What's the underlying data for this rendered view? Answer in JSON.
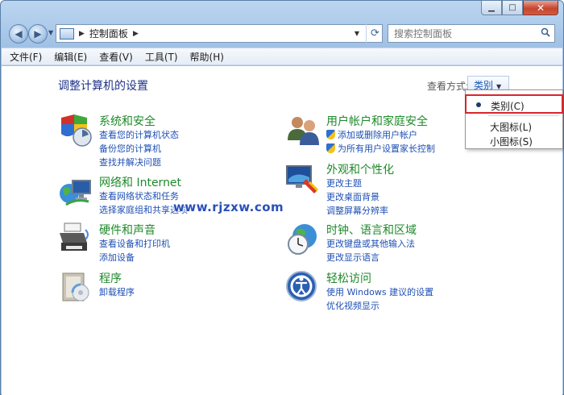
{
  "window": {
    "caption": {
      "minimize_glyph": "▁",
      "maximize_glyph": "□",
      "close_glyph": "✕"
    }
  },
  "nav": {
    "back_glyph": "◀",
    "forward_glyph": "▶",
    "address_path": "控制面板",
    "address_sep": "▶",
    "address_tail": "▶",
    "refresh_glyph": "⟳",
    "search_placeholder": "搜索控制面板"
  },
  "menubar": {
    "items": [
      "文件(F)",
      "编辑(E)",
      "查看(V)",
      "工具(T)",
      "帮助(H)"
    ]
  },
  "content": {
    "title": "调整计算机的设置",
    "view_label": "查看方式:",
    "view_value": "类别",
    "watermark": "www.rjzxw.com",
    "categories": [
      {
        "title": "系统和安全",
        "icon": "system-security-icon",
        "links": [
          "查看您的计算机状态",
          "备份您的计算机",
          "查找并解决问题"
        ]
      },
      {
        "title": "网络和 Internet",
        "icon": "network-internet-icon",
        "links": [
          "查看网络状态和任务",
          "选择家庭组和共享选项"
        ]
      },
      {
        "title": "硬件和声音",
        "icon": "hardware-sound-icon",
        "links": [
          "查看设备和打印机",
          "添加设备"
        ]
      },
      {
        "title": "程序",
        "icon": "programs-icon",
        "links": [
          "卸载程序"
        ]
      },
      {
        "title": "用户帐户和家庭安全",
        "icon": "user-accounts-icon",
        "links": [
          "添加或删除用户帐户",
          "为所有用户设置家长控制"
        ]
      },
      {
        "title": "外观和个性化",
        "icon": "appearance-icon",
        "links": [
          "更改主题",
          "更改桌面背景",
          "调整屏幕分辨率"
        ]
      },
      {
        "title": "时钟、语言和区域",
        "icon": "clock-language-icon",
        "links": [
          "更改键盘或其他输入法",
          "更改显示语言"
        ]
      },
      {
        "title": "轻松访问",
        "icon": "ease-of-access-icon",
        "links": [
          "使用 Windows 建议的设置",
          "优化视频显示"
        ]
      }
    ]
  },
  "dropdown": {
    "items": [
      "类别(C)",
      "大图标(L)",
      "小图标(S)"
    ],
    "selected": "类别(C)"
  }
}
